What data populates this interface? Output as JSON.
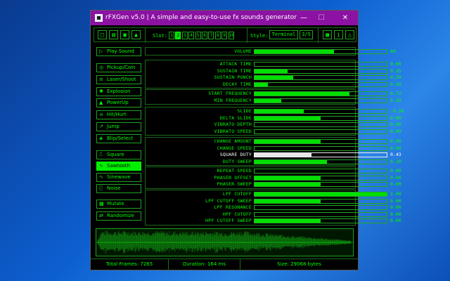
{
  "window": {
    "title": "rFXGen v5.0 | A simple and easy-to-use fx sounds generator"
  },
  "toolbar": {
    "file_icons": [
      "new-icon",
      "open-icon",
      "save-icon",
      "export-icon"
    ],
    "slot_label": "Slot:",
    "slots": [
      "1",
      "2",
      "3",
      "4",
      "5",
      "6",
      "7",
      "8",
      "9",
      "10"
    ],
    "active_slot": "2",
    "style_label": "Style:",
    "style_value": "Terminal",
    "style_page": "3/5",
    "right_icons": [
      "window-icon",
      "info-icon",
      "warning-icon"
    ]
  },
  "left": {
    "play_label": "Play Sound",
    "presets": [
      {
        "icon": "coin-icon",
        "label": "Pickup/Coin"
      },
      {
        "icon": "laser-icon",
        "label": "Laser/Shoot"
      },
      {
        "icon": "explosion-icon",
        "label": "Explosion"
      },
      {
        "icon": "powerup-icon",
        "label": "PowerUp"
      },
      {
        "icon": "hit-icon",
        "label": "Hit/Hurt"
      },
      {
        "icon": "jump-icon",
        "label": "Jump"
      },
      {
        "icon": "blip-icon",
        "label": "Blip/Select"
      }
    ],
    "waves": [
      {
        "icon": "square-wave-icon",
        "label": "Square"
      },
      {
        "icon": "sawtooth-wave-icon",
        "label": "Sawtooth"
      },
      {
        "icon": "sine-wave-icon",
        "label": "Sinewave"
      },
      {
        "icon": "noise-icon",
        "label": "Noise"
      }
    ],
    "active_wave": "Sawtooth",
    "mutate_label": "Mutate",
    "randomize_label": "Randomize"
  },
  "params": {
    "volume": {
      "name": "VOLUME",
      "value": "60",
      "level": 0.6
    },
    "groups": [
      [
        {
          "name": "ATTACK TIME",
          "value": "0.00",
          "level": 0.0
        },
        {
          "name": "SUSTAIN TIME",
          "value": "0.25",
          "level": 0.25
        },
        {
          "name": "SUSTAIN PUNCH",
          "value": "0.29",
          "level": 0.29
        },
        {
          "name": "DECAY TIME",
          "value": "0.10",
          "level": 0.1
        }
      ],
      [
        {
          "name": "START FREQUENCY",
          "value": "0.72",
          "level": 0.72
        },
        {
          "name": "MIN FREQUENCY",
          "value": "0.20",
          "level": 0.2
        }
      ],
      [
        {
          "name": "SLIDE",
          "value": "-0.26",
          "level": 0.37
        },
        {
          "name": "DELTA SLIDE",
          "value": "0.00",
          "level": 0.5
        },
        {
          "name": "VIBRATO DEPTH",
          "value": "0.00",
          "level": 0.0
        },
        {
          "name": "VIBRATO SPEED",
          "value": "0.00",
          "level": 0.0
        }
      ],
      [
        {
          "name": "CHANGE AMOUNT",
          "value": "0.00",
          "level": 0.5
        },
        {
          "name": "CHANGE SPEED",
          "value": "0.00",
          "level": 0.0
        },
        {
          "name": "SQUARE DUTY",
          "value": "0.43",
          "level": 0.43,
          "highlight": true
        },
        {
          "name": "DUTY SWEEP",
          "value": "0.10",
          "level": 0.55
        }
      ],
      [
        {
          "name": "REPEAT SPEED",
          "value": "0.00",
          "level": 0.0
        },
        {
          "name": "PHASER OFFSET",
          "value": "0.00",
          "level": 0.5
        },
        {
          "name": "PHASER SWEEP",
          "value": "0.00",
          "level": 0.5
        }
      ],
      [
        {
          "name": "LPF CUTOFF",
          "value": "1.00",
          "level": 1.0
        },
        {
          "name": "LPF CUTOFF SWEEP",
          "value": "0.00",
          "level": 0.5
        },
        {
          "name": "LPF RESONANCE",
          "value": "0.00",
          "level": 0.0
        },
        {
          "name": "HPF CUTOFF",
          "value": "0.00",
          "level": 0.0
        },
        {
          "name": "HPF CUTOFF SWEEP",
          "value": "0.00",
          "level": 0.5
        }
      ]
    ]
  },
  "status": {
    "frames": "Total Frames: 7265",
    "duration": "Duration: 164 ms",
    "size": "Size: 29068 bytes"
  }
}
